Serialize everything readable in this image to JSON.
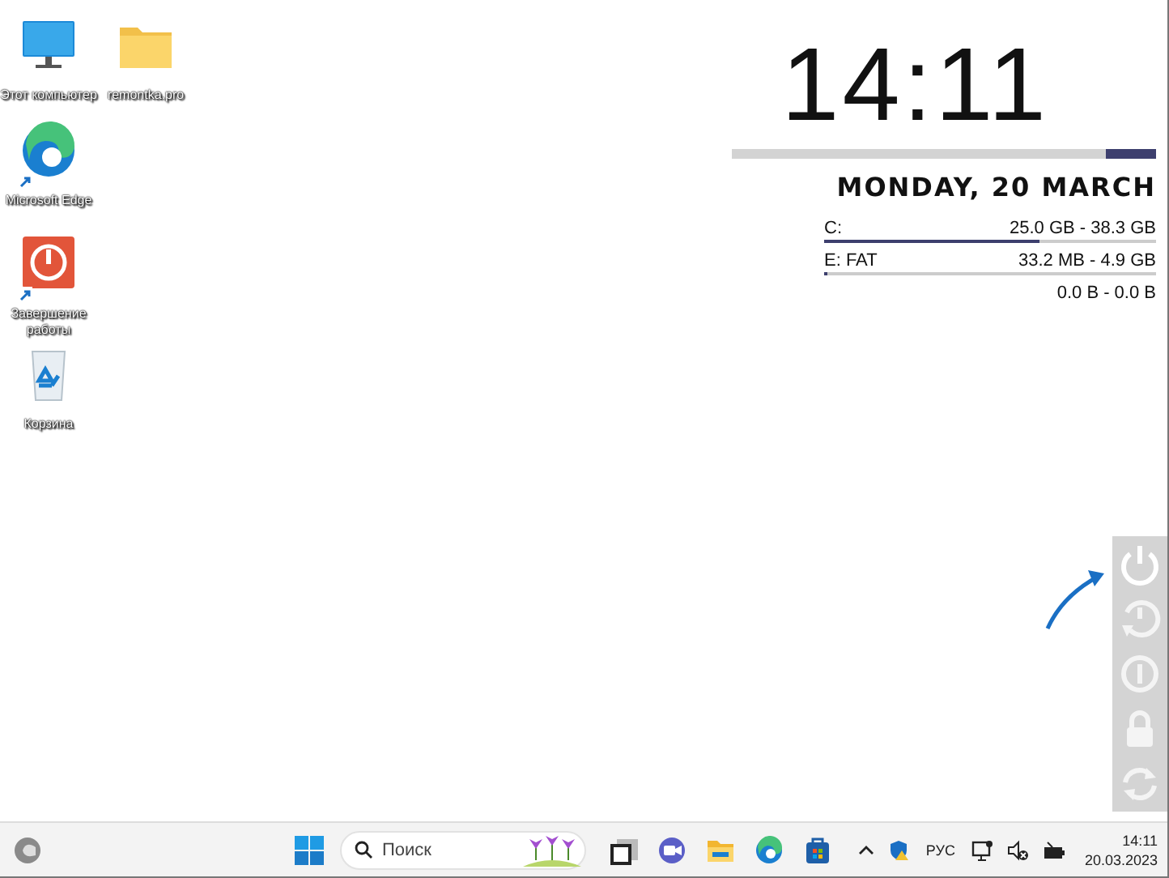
{
  "desktop": {
    "icons": [
      {
        "kind": "computer",
        "label": "Этот компьютер",
        "shortcut": false
      },
      {
        "kind": "folder",
        "label": "remontka.pro",
        "shortcut": false
      },
      {
        "kind": "browser",
        "label": "Microsoft Edge",
        "shortcut": true
      },
      {
        "kind": "power",
        "label": "Завершение работы",
        "shortcut": true
      },
      {
        "kind": "recycle",
        "label": "Корзина",
        "shortcut": false
      }
    ]
  },
  "widget": {
    "time": "14:11",
    "level": 0.88,
    "date": "MONDAY, 20 MARCH",
    "drives": [
      {
        "label": "C:",
        "reading": "25.0 GB - 38.3 GB",
        "level": 0.65
      },
      {
        "label": "E: FAT",
        "reading": "33.2 MB - 4.9 GB",
        "level": 0.01
      },
      {
        "reading": "0.0 B - 0.0 B"
      }
    ]
  },
  "power_panel": {
    "buttons": [
      {
        "kind": "power"
      },
      {
        "kind": "restart"
      },
      {
        "kind": "shutdown"
      },
      {
        "kind": "lock"
      },
      {
        "kind": "refresh"
      }
    ]
  },
  "taskbar": {
    "search": {
      "placeholder": "Поиск"
    },
    "apps": [
      {
        "kind": "taskview"
      },
      {
        "kind": "meet"
      },
      {
        "kind": "explorer"
      },
      {
        "kind": "browser"
      },
      {
        "kind": "store"
      }
    ],
    "tray": {
      "language": "РУС",
      "time": "14:11",
      "date": "20.03.2023"
    }
  }
}
